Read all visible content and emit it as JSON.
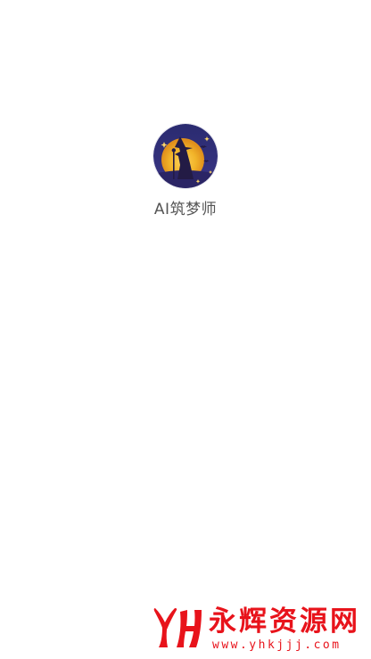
{
  "splash": {
    "app_name": "AI筑梦师",
    "logo_icon": "witch-moon-logo-icon",
    "text_color": "#555555"
  },
  "watermark": {
    "logo_icon": "yh-logo-icon",
    "title": "永辉资源网",
    "url": "www.yhkjjj.com",
    "color": "#e8131b"
  },
  "colors": {
    "background": "#ffffff",
    "logo_sky": "#2e2f78",
    "logo_moon": "#f2b52a"
  }
}
